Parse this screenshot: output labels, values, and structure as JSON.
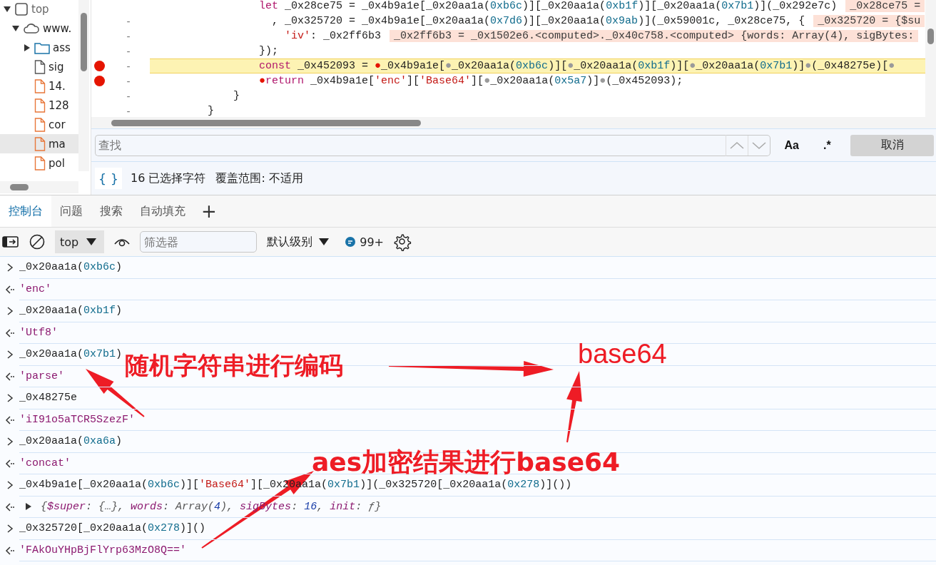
{
  "file_tree": [
    {
      "label": "top",
      "kind": "frame",
      "expanded": true,
      "selected": false,
      "children": [
        {
          "label": "www.",
          "kind": "origin",
          "expanded": true,
          "selected": false,
          "children": [
            {
              "label": "ass",
              "kind": "folder",
              "expanded": false,
              "selected": false
            },
            {
              "label": "sig",
              "kind": "document",
              "selected": false
            },
            {
              "label": "14.",
              "kind": "script",
              "selected": false
            },
            {
              "label": "128",
              "kind": "script",
              "selected": false
            },
            {
              "label": "cor",
              "kind": "script",
              "selected": false
            },
            {
              "label": "ma",
              "kind": "script",
              "selected": true
            },
            {
              "label": "pol",
              "kind": "script",
              "selected": false
            }
          ]
        }
      ]
    }
  ],
  "editor": {
    "lines": [
      {
        "breakpoint": false,
        "current": false,
        "text": "let _0x28ce75 = _0x4b9a1e[_0x20aa1a(0xb6c)][_0x20aa1a(0xb1f)][_0x20aa1a(0x7b1)](_0x292e7c)",
        "inline_value": "_0x28ce75 ="
      },
      {
        "gutter": "-",
        "breakpoint": false,
        "current": false,
        "text": ", _0x325720 = _0x4b9a1e[_0x20aa1a(0x7d6)][_0x20aa1a(0x9ab)](_0x59001c, _0x28ce75, {",
        "inline_value": "_0x325720 = {$su"
      },
      {
        "gutter": "-",
        "breakpoint": false,
        "current": false,
        "text": "'iv': _0x2ff6b3",
        "inline_value": "_0x2ff6b3 = _0x1502e6.<computed>._0x40c758.<computed> {words: Array(4), sigBytes:"
      },
      {
        "gutter": "-",
        "breakpoint": false,
        "current": false,
        "text": "});"
      },
      {
        "gutter": "-",
        "breakpoint": true,
        "current": true,
        "text": "const _0x452093 = ●_0x4b9a1e[●_0x20aa1a(0xb6c)][●_0x20aa1a(0xb1f)][●_0x20aa1a(0x7b1)]●(_0x48275e)[●"
      },
      {
        "gutter": "-",
        "breakpoint": true,
        "current": false,
        "text": "●return _0x4b9a1e['enc']['Base64'][●_0x20aa1a(0x5a7)]●(_0x452093);"
      },
      {
        "gutter": "-",
        "breakpoint": false,
        "current": false,
        "text": "}"
      },
      {
        "gutter": "-",
        "breakpoint": false,
        "current": false,
        "text": "}"
      }
    ]
  },
  "find_bar": {
    "placeholder": "查找",
    "match_case": "Aa",
    "regex": ".*",
    "cancel": "取消"
  },
  "status_bar": {
    "pretty_print": "{ }",
    "selection": "16 已选择字符",
    "coverage": "覆盖范围: 不适用"
  },
  "drawer_tabs": [
    {
      "label": "控制台",
      "selected": true
    },
    {
      "label": "问题",
      "selected": false
    },
    {
      "label": "搜索",
      "selected": false
    },
    {
      "label": "自动填充",
      "selected": false
    }
  ],
  "add_tab": "+",
  "console_toolbar": {
    "context": "top",
    "filter_placeholder": "筛选器",
    "level": "默认级别",
    "messages": "99+"
  },
  "console_rows": [
    {
      "kind": "input",
      "text": "_0x20aa1a(0xb6c)"
    },
    {
      "kind": "output",
      "text": "'enc'"
    },
    {
      "kind": "input",
      "text": "_0x20aa1a(0xb1f)"
    },
    {
      "kind": "output",
      "text": "'Utf8'"
    },
    {
      "kind": "input",
      "text": "_0x20aa1a(0x7b1)"
    },
    {
      "kind": "output",
      "text": "'parse'"
    },
    {
      "kind": "input",
      "text": "_0x48275e"
    },
    {
      "kind": "output",
      "text": "'iI91o5aTCR5SzezF'"
    },
    {
      "kind": "input",
      "text": "_0x20aa1a(0xa6a)"
    },
    {
      "kind": "output",
      "text": "'concat'"
    },
    {
      "kind": "input",
      "text": "_0x4b9a1e[_0x20aa1a(0xb6c)]['Base64'][_0x20aa1a(0x7b1)](_0x325720[_0x20aa1a(0x278)]())"
    },
    {
      "kind": "object",
      "expanded": false,
      "text": "{$super: {…}, words: Array(4), sigBytes: 16, init: ƒ}"
    },
    {
      "kind": "input",
      "text": "_0x325720[_0x20aa1a(0x278)]()"
    },
    {
      "kind": "output",
      "text": "'FAkOuYHpBjFlYrp63MzO8Q=='"
    }
  ],
  "annotations": [
    "随机字符串进行编码",
    "base64",
    "aes加密结果进行base64"
  ]
}
